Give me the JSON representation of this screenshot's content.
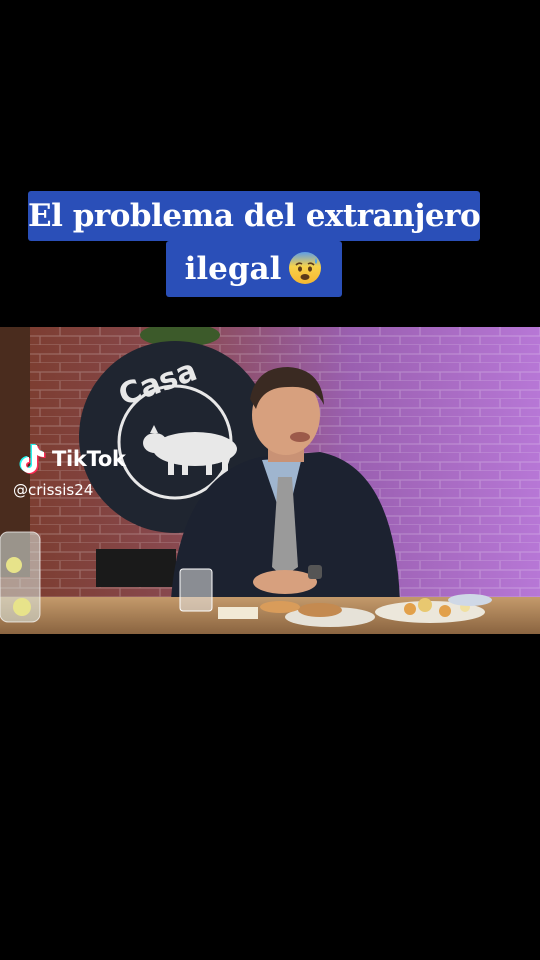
{
  "caption": {
    "line1": "El problema del extranjero",
    "line2": "ilegal",
    "emoji": "anxious-face-with-sweat-icon"
  },
  "video": {
    "sign_text": "Casa"
  },
  "watermark": {
    "brand": "TikTok",
    "username": "@crissis24"
  },
  "colors": {
    "caption_bg": "#2a4fb8",
    "background": "#000000",
    "wall_light": "#b777d6"
  }
}
